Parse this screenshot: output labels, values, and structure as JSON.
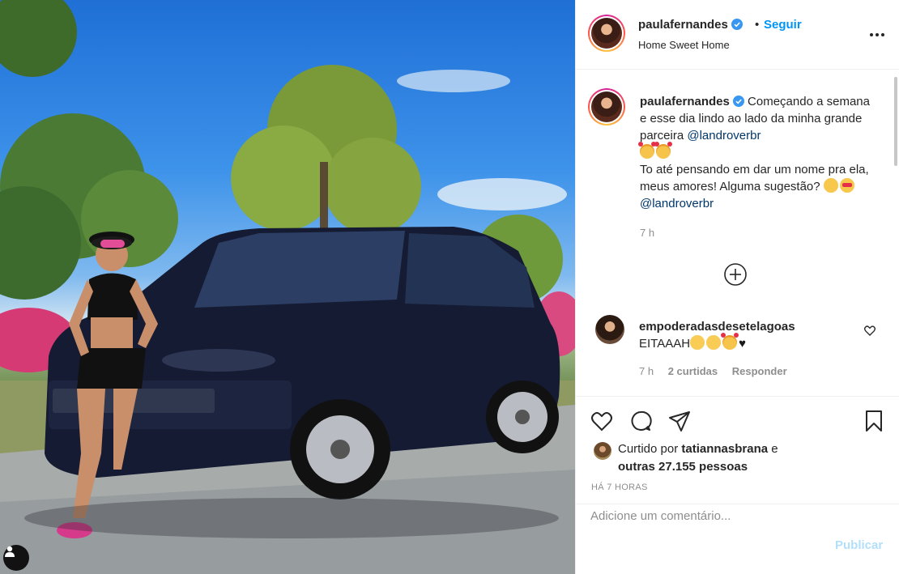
{
  "post": {
    "username": "paulafernandes",
    "verified": true,
    "follow_label": "Seguir",
    "separator": "•",
    "location": "Home Sweet Home",
    "more_icon": "more-horizontal-icon"
  },
  "caption": {
    "username": "paulafernandes",
    "text_part1": "Começando a semana e esse dia lindo ao lado da minha grande parceira",
    "mention1": "@landroverbr",
    "text_part2": "To até pensando em dar um nome pra ela, meus amores! Alguma sugestão?",
    "mention2": "@landroverbr",
    "time": "7 h"
  },
  "load_more_icon": "plus-circle-icon",
  "comment": {
    "username": "empoderadasdesetelagoas",
    "text": "EITAAAH",
    "time": "7 h",
    "likes": "2 curtidas",
    "reply_label": "Responder"
  },
  "likes": {
    "prefix": "Curtido por",
    "user": "tatiannasbrana",
    "middle": "e",
    "others": "outras 27.155 pessoas"
  },
  "timestamp": "HÁ 7 HORAS",
  "add_comment": {
    "placeholder": "Adicione um comentário...",
    "publish_label": "Publicar"
  },
  "colors": {
    "accent": "#0095f6",
    "publish_disabled": "#b2dffc",
    "muted": "#8e8e8e",
    "mention": "#00376b"
  }
}
